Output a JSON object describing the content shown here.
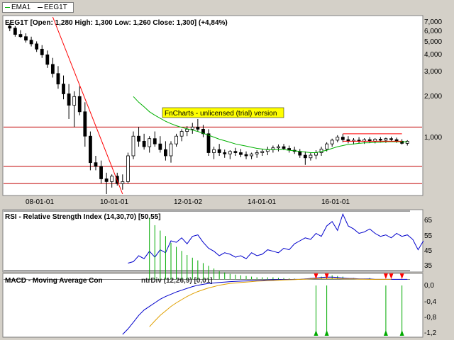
{
  "legend": {
    "items": [
      {
        "label": "EMA1",
        "color": "#00b000"
      },
      {
        "label": "EEG1T",
        "color": "#000000"
      }
    ]
  },
  "panels": {
    "price": {
      "title": "EEG1T [Open: 1,280  High: 1,300  Low: 1,260  Close: 1,300] (+4,84%)",
      "y_ticks": [
        "7,000",
        "6,000",
        "5,000",
        "4,000",
        "3,000",
        "2,000",
        "1,000"
      ],
      "x_ticks": [
        "08-01-01",
        "10-01-01",
        "12-01-02",
        "14-01-01",
        "16-01-01"
      ],
      "watermark": "FnCharts - unlicensed (trial) version"
    },
    "rsi": {
      "title": "RSI - Relative Strength Index (14,30,70) [50,55]",
      "y_ticks": [
        "65",
        "55",
        "45",
        "35"
      ]
    },
    "macd": {
      "title": "MACD - Moving Average Convergence Divergence (12,26,9) [0,01]",
      "title_visible": "MACD - Moving Average Con",
      "title_overlap": "ntrDiv (12,26,9) [0,01]",
      "y_ticks": [
        "0,0",
        "-0,4",
        "-0,8",
        "-1,2"
      ]
    }
  },
  "colors": {
    "background": "#d4d0c8",
    "plot_bg": "#ffffff",
    "candle": "#000000",
    "ema": "#00b000",
    "trend_line": "#ff0000",
    "level_line": "#c00000",
    "rsi": "#0000cc",
    "macd": "#0000cc",
    "signal": "#e0a000",
    "histogram": "#00aa00",
    "markers": "#ff0000",
    "watermark_bg": "#ffff00"
  },
  "chart_data": [
    {
      "type": "candlestick",
      "title": "EEG1T [Open: 1,280  High: 1,300  Low: 1,260  Close: 1,300] (+4,84%)",
      "log_scale": true,
      "ylim": [
        0.6,
        8.0
      ],
      "x_tick_labels": [
        "08-01-01",
        "10-01-01",
        "12-01-02",
        "14-01-01",
        "16-01-01"
      ],
      "series": [
        {
          "name": "EEG1T",
          "points": [
            {
              "o": 7.0,
              "h": 7.3,
              "l": 6.5,
              "c": 6.8
            },
            {
              "o": 6.8,
              "h": 7.0,
              "l": 6.0,
              "c": 6.2
            },
            {
              "o": 6.2,
              "h": 6.6,
              "l": 5.9,
              "c": 6.0
            },
            {
              "o": 6.0,
              "h": 6.3,
              "l": 5.5,
              "c": 5.7
            },
            {
              "o": 5.7,
              "h": 6.0,
              "l": 5.2,
              "c": 5.4
            },
            {
              "o": 5.4,
              "h": 5.6,
              "l": 4.8,
              "c": 5.0
            },
            {
              "o": 5.0,
              "h": 5.3,
              "l": 4.4,
              "c": 4.6
            },
            {
              "o": 4.6,
              "h": 4.9,
              "l": 3.8,
              "c": 4.0
            },
            {
              "o": 4.0,
              "h": 4.4,
              "l": 3.3,
              "c": 3.5
            },
            {
              "o": 3.5,
              "h": 3.9,
              "l": 2.8,
              "c": 3.0
            },
            {
              "o": 3.0,
              "h": 3.4,
              "l": 2.4,
              "c": 2.6
            },
            {
              "o": 2.6,
              "h": 3.0,
              "l": 1.8,
              "c": 2.2
            },
            {
              "o": 2.2,
              "h": 2.7,
              "l": 1.6,
              "c": 2.5
            },
            {
              "o": 2.5,
              "h": 2.9,
              "l": 1.9,
              "c": 2.0
            },
            {
              "o": 2.0,
              "h": 2.3,
              "l": 1.2,
              "c": 1.4
            },
            {
              "o": 1.4,
              "h": 1.5,
              "l": 0.85,
              "c": 0.95
            },
            {
              "o": 0.95,
              "h": 1.05,
              "l": 0.85,
              "c": 0.9
            },
            {
              "o": 0.9,
              "h": 0.98,
              "l": 0.7,
              "c": 0.75
            },
            {
              "o": 0.75,
              "h": 0.82,
              "l": 0.6,
              "c": 0.72
            },
            {
              "o": 0.72,
              "h": 0.8,
              "l": 0.66,
              "c": 0.78
            },
            {
              "o": 0.78,
              "h": 0.82,
              "l": 0.68,
              "c": 0.7
            },
            {
              "o": 0.7,
              "h": 0.8,
              "l": 0.64,
              "c": 0.72
            },
            {
              "o": 0.72,
              "h": 1.1,
              "l": 0.7,
              "c": 1.05
            },
            {
              "o": 1.05,
              "h": 1.5,
              "l": 1.0,
              "c": 1.4
            },
            {
              "o": 1.4,
              "h": 1.6,
              "l": 1.2,
              "c": 1.3
            },
            {
              "o": 1.3,
              "h": 1.45,
              "l": 1.15,
              "c": 1.2
            },
            {
              "o": 1.2,
              "h": 1.4,
              "l": 1.1,
              "c": 1.35
            },
            {
              "o": 1.35,
              "h": 1.5,
              "l": 1.2,
              "c": 1.25
            },
            {
              "o": 1.25,
              "h": 1.4,
              "l": 1.1,
              "c": 1.15
            },
            {
              "o": 1.15,
              "h": 1.3,
              "l": 0.98,
              "c": 1.05
            },
            {
              "o": 1.05,
              "h": 1.3,
              "l": 0.95,
              "c": 1.25
            },
            {
              "o": 1.25,
              "h": 1.45,
              "l": 1.2,
              "c": 1.4
            },
            {
              "o": 1.4,
              "h": 1.55,
              "l": 1.3,
              "c": 1.5
            },
            {
              "o": 1.5,
              "h": 1.62,
              "l": 1.4,
              "c": 1.55
            },
            {
              "o": 1.55,
              "h": 1.7,
              "l": 1.45,
              "c": 1.6
            },
            {
              "o": 1.6,
              "h": 1.8,
              "l": 1.5,
              "c": 1.55
            },
            {
              "o": 1.55,
              "h": 1.65,
              "l": 1.38,
              "c": 1.45
            },
            {
              "o": 1.45,
              "h": 1.55,
              "l": 1.05,
              "c": 1.1
            },
            {
              "o": 1.1,
              "h": 1.2,
              "l": 1.0,
              "c": 1.15
            },
            {
              "o": 1.15,
              "h": 1.25,
              "l": 1.05,
              "c": 1.1
            },
            {
              "o": 1.1,
              "h": 1.15,
              "l": 1.02,
              "c": 1.08
            },
            {
              "o": 1.08,
              "h": 1.14,
              "l": 1.0,
              "c": 1.12
            },
            {
              "o": 1.12,
              "h": 1.18,
              "l": 1.05,
              "c": 1.1
            },
            {
              "o": 1.1,
              "h": 1.16,
              "l": 1.03,
              "c": 1.07
            },
            {
              "o": 1.07,
              "h": 1.12,
              "l": 1.0,
              "c": 1.05
            },
            {
              "o": 1.05,
              "h": 1.1,
              "l": 1.0,
              "c": 1.08
            },
            {
              "o": 1.08,
              "h": 1.14,
              "l": 1.02,
              "c": 1.1
            },
            {
              "o": 1.1,
              "h": 1.16,
              "l": 1.05,
              "c": 1.12
            },
            {
              "o": 1.12,
              "h": 1.2,
              "l": 1.06,
              "c": 1.15
            },
            {
              "o": 1.15,
              "h": 1.22,
              "l": 1.1,
              "c": 1.18
            },
            {
              "o": 1.18,
              "h": 1.24,
              "l": 1.12,
              "c": 1.2
            },
            {
              "o": 1.2,
              "h": 1.25,
              "l": 1.14,
              "c": 1.17
            },
            {
              "o": 1.17,
              "h": 1.22,
              "l": 1.1,
              "c": 1.14
            },
            {
              "o": 1.14,
              "h": 1.2,
              "l": 1.08,
              "c": 1.12
            },
            {
              "o": 1.12,
              "h": 1.16,
              "l": 1.02,
              "c": 1.06
            },
            {
              "o": 1.06,
              "h": 1.12,
              "l": 0.92,
              "c": 1.02
            },
            {
              "o": 1.02,
              "h": 1.1,
              "l": 0.98,
              "c": 1.06
            },
            {
              "o": 1.06,
              "h": 1.14,
              "l": 1.0,
              "c": 1.1
            },
            {
              "o": 1.1,
              "h": 1.2,
              "l": 1.05,
              "c": 1.16
            },
            {
              "o": 1.16,
              "h": 1.28,
              "l": 1.12,
              "c": 1.25
            },
            {
              "o": 1.25,
              "h": 1.35,
              "l": 1.2,
              "c": 1.32
            },
            {
              "o": 1.32,
              "h": 1.42,
              "l": 1.28,
              "c": 1.38
            },
            {
              "o": 1.38,
              "h": 1.45,
              "l": 1.28,
              "c": 1.33
            },
            {
              "o": 1.33,
              "h": 1.4,
              "l": 1.26,
              "c": 1.3
            },
            {
              "o": 1.3,
              "h": 1.36,
              "l": 1.24,
              "c": 1.32
            },
            {
              "o": 1.32,
              "h": 1.38,
              "l": 1.26,
              "c": 1.3
            },
            {
              "o": 1.3,
              "h": 1.36,
              "l": 1.25,
              "c": 1.33
            },
            {
              "o": 1.33,
              "h": 1.38,
              "l": 1.27,
              "c": 1.3
            },
            {
              "o": 1.3,
              "h": 1.36,
              "l": 1.26,
              "c": 1.34
            },
            {
              "o": 1.34,
              "h": 1.38,
              "l": 1.28,
              "c": 1.32
            },
            {
              "o": 1.32,
              "h": 1.37,
              "l": 1.27,
              "c": 1.35
            },
            {
              "o": 1.35,
              "h": 1.39,
              "l": 1.3,
              "c": 1.33
            },
            {
              "o": 1.33,
              "h": 1.37,
              "l": 1.27,
              "c": 1.3
            },
            {
              "o": 1.3,
              "h": 1.34,
              "l": 1.24,
              "c": 1.26
            },
            {
              "o": 1.26,
              "h": 1.32,
              "l": 1.22,
              "c": 1.3
            }
          ]
        },
        {
          "name": "EMA1",
          "values": [
            null,
            null,
            null,
            null,
            null,
            null,
            null,
            null,
            null,
            null,
            null,
            null,
            null,
            null,
            null,
            null,
            null,
            null,
            null,
            null,
            null,
            null,
            null,
            2.5,
            2.3,
            2.15,
            2.0,
            1.9,
            1.82,
            1.74,
            1.68,
            1.63,
            1.59,
            1.56,
            1.53,
            1.5,
            1.46,
            1.42,
            1.38,
            1.34,
            1.31,
            1.28,
            1.25,
            1.23,
            1.21,
            1.19,
            1.17,
            1.16,
            1.15,
            1.15,
            1.15,
            1.15,
            1.14,
            1.13,
            1.12,
            1.11,
            1.1,
            1.1,
            1.12,
            1.14,
            1.17,
            1.2,
            1.22,
            1.24,
            1.25,
            1.26,
            1.27,
            1.27,
            1.28,
            1.28,
            1.29,
            1.29,
            1.29,
            1.29,
            1.29
          ]
        }
      ],
      "horizontal_levels": [
        1.6,
        0.9,
        0.7
      ],
      "trend_lines": [
        {
          "x": [
            8,
            21
          ],
          "y": [
            8.0,
            0.6
          ]
        },
        {
          "x": [
            62,
            73
          ],
          "y": [
            1.45,
            1.45
          ]
        },
        {
          "x": [
            62,
            73
          ],
          "y": [
            1.3,
            1.3
          ]
        }
      ]
    },
    {
      "type": "line",
      "title": "RSI - Relative Strength Index (14,30,70) [50,55]",
      "ylim": [
        30,
        70
      ],
      "y_ticks": [
        65,
        55,
        45,
        35
      ],
      "series": [
        {
          "name": "RSI",
          "values": [
            null,
            null,
            null,
            null,
            null,
            null,
            null,
            null,
            null,
            null,
            null,
            null,
            null,
            null,
            null,
            null,
            null,
            null,
            null,
            null,
            null,
            null,
            35,
            36,
            40,
            38,
            43,
            39,
            44,
            42,
            50,
            49,
            52,
            48,
            53,
            54,
            49,
            45,
            43,
            40,
            42,
            41,
            39,
            40,
            38,
            42,
            40,
            41,
            44,
            43,
            42,
            45,
            44,
            48,
            50,
            52,
            51,
            55,
            53,
            60,
            63,
            57,
            68,
            60,
            58,
            55,
            56,
            58,
            55,
            53,
            54,
            52,
            55,
            53,
            54,
            51,
            44,
            50
          ]
        }
      ],
      "levels": [
        70,
        30
      ]
    },
    {
      "type": "line",
      "title": "MACD - Moving Average Convergence Divergence (12,26,9) [0,01]",
      "ylim": [
        -1.25,
        0.1
      ],
      "y_ticks": [
        0.0,
        -0.4,
        -0.8,
        -1.2
      ],
      "series": [
        {
          "name": "MACD",
          "values": [
            null,
            null,
            null,
            null,
            null,
            null,
            null,
            null,
            null,
            null,
            null,
            null,
            null,
            null,
            null,
            null,
            null,
            null,
            null,
            null,
            null,
            -1.22,
            -1.1,
            -0.95,
            -0.8,
            -0.68,
            -0.6,
            -0.52,
            -0.44,
            -0.38,
            -0.33,
            -0.28,
            -0.24,
            -0.2,
            -0.16,
            -0.13,
            -0.11,
            -0.09,
            -0.08,
            -0.07,
            -0.06,
            -0.05,
            -0.045,
            -0.04,
            -0.035,
            -0.03,
            -0.025,
            -0.02,
            -0.015,
            -0.01,
            -0.008,
            -0.005,
            -0.003,
            0.0,
            0.0,
            0.01,
            0.02,
            0.03,
            0.04,
            0.05,
            0.05,
            0.04,
            0.03,
            0.02,
            0.02,
            0.01,
            0.01,
            0.01,
            0.0,
            0.0,
            0.0,
            0.0,
            0.0,
            0.0,
            0.0
          ]
        },
        {
          "name": "Signal",
          "values": [
            null,
            null,
            null,
            null,
            null,
            null,
            null,
            null,
            null,
            null,
            null,
            null,
            null,
            null,
            null,
            null,
            null,
            null,
            null,
            null,
            null,
            null,
            null,
            null,
            null,
            null,
            -1.05,
            -0.92,
            -0.8,
            -0.7,
            -0.6,
            -0.52,
            -0.45,
            -0.38,
            -0.32,
            -0.27,
            -0.23,
            -0.19,
            -0.16,
            -0.13,
            -0.11,
            -0.09,
            -0.08,
            -0.07,
            -0.06,
            -0.05,
            -0.04,
            -0.035,
            -0.03,
            -0.025,
            -0.02,
            -0.015,
            -0.01,
            -0.005,
            0.0,
            0.005,
            0.01,
            0.015,
            0.02,
            0.02,
            0.02,
            0.015,
            0.01,
            0.01,
            0.01,
            0.005,
            0.005,
            0.0,
            0.0,
            0.0,
            0.0,
            0.0
          ]
        }
      ],
      "sell_markers_at": [
        57,
        59,
        70,
        71,
        73
      ],
      "buy_markers_at": [
        57,
        59,
        70,
        73
      ]
    }
  ]
}
